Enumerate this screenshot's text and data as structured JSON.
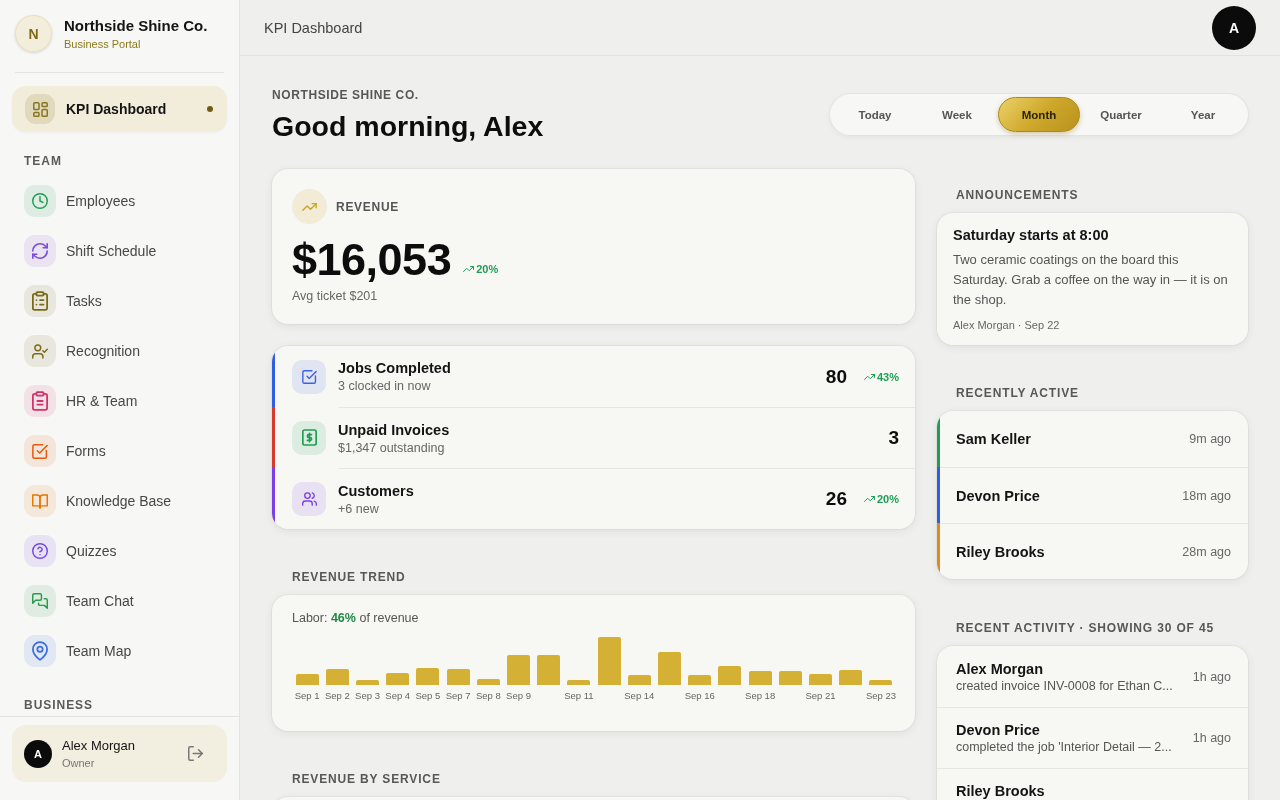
{
  "sidebar": {
    "brand": {
      "initial": "N",
      "name": "Northside Shine Co.",
      "subtitle": "Business Portal"
    },
    "nav": [
      {
        "label": "KPI Dashboard",
        "color": "#8a7520",
        "selected": true
      }
    ],
    "sections": [
      {
        "title": "TEAM",
        "items": [
          {
            "label": "Employees",
            "color": "#1f9d55",
            "selected": false
          },
          {
            "label": "Shift Schedule",
            "color": "#7c4ddb",
            "selected": false
          },
          {
            "label": "Tasks",
            "color": "#7a6a1a",
            "selected": false
          },
          {
            "label": "Recognition",
            "color": "#7a6a1a",
            "selected": false
          },
          {
            "label": "HR & Team",
            "color": "#d6336c",
            "selected": false
          },
          {
            "label": "Forms",
            "color": "#e8590c",
            "selected": false
          },
          {
            "label": "Knowledge Base",
            "color": "#e67700",
            "selected": false
          },
          {
            "label": "Quizzes",
            "color": "#7048e8",
            "selected": false
          },
          {
            "label": "Team Chat",
            "color": "#2b9a4a",
            "selected": false
          },
          {
            "label": "Team Map",
            "color": "#3b6fe0",
            "selected": false
          }
        ]
      },
      {
        "title": "BUSINESS"
      }
    ],
    "user": {
      "initial": "A",
      "name": "Alex Morgan",
      "role": "Owner"
    }
  },
  "topbar": {
    "title": "KPI Dashboard",
    "avatar": "A"
  },
  "header": {
    "eyebrow": "NORTHSIDE SHINE CO.",
    "greeting": "Good morning, Alex"
  },
  "periods": [
    {
      "label": "Today",
      "selected": false
    },
    {
      "label": "Week",
      "selected": false
    },
    {
      "label": "Month",
      "selected": true
    },
    {
      "label": "Quarter",
      "selected": false
    },
    {
      "label": "Year",
      "selected": false
    }
  ],
  "revenue": {
    "label": "REVENUE",
    "value": "$16,053",
    "trend": "20%",
    "note": "Avg ticket $201"
  },
  "kpis": [
    {
      "title": "Jobs Completed",
      "subtitle": "3 clocked in now",
      "value": "80",
      "trend": "43%",
      "color": "#2f5fe0"
    },
    {
      "title": "Unpaid Invoices",
      "subtitle": "$1,347 outstanding",
      "value": "3",
      "color": "#d63a2f"
    },
    {
      "title": "Customers",
      "subtitle": "+6 new",
      "value": "26",
      "trend": "20%",
      "color": "#7b3fe4"
    }
  ],
  "revenue_trend": {
    "heading": "REVENUE TREND",
    "note": "Labor: **46%** of revenue",
    "x_labels": [
      "Sep 1",
      "Sep 2",
      "Sep 3",
      "Sep 4",
      "Sep 5",
      "Sep 7",
      "Sep 8",
      "Sep 9",
      "Sep 11",
      "Sep 14",
      "Sep 16",
      "Sep 18",
      "Sep 21",
      "Sep 23"
    ]
  },
  "revenue_by_service": {
    "heading": "REVENUE BY SERVICE"
  },
  "announcements": {
    "heading": "ANNOUNCEMENTS",
    "items": [
      {
        "title": "Saturday starts at 8:00",
        "body": "Two ceramic coatings on the board this Saturday. Grab a coffee on the way in — it is on the shop.",
        "meta": "Alex Morgan · Sep 22"
      }
    ]
  },
  "recently_active": {
    "heading": "RECENTLY ACTIVE",
    "items": [
      {
        "name": "Sam Keller",
        "time": "9m ago",
        "color": "#1f9d55"
      },
      {
        "name": "Devon Price",
        "time": "18m ago",
        "color": "#2f5fe0"
      },
      {
        "name": "Riley Brooks",
        "time": "28m ago",
        "color": "#e08a1a"
      }
    ]
  },
  "recent_activity": {
    "heading": "RECENT ACTIVITY · SHOWING 30 OF 45",
    "items": [
      {
        "name": "Alex Morgan",
        "description": "created invoice INV-0008 for Ethan C...",
        "time": "1h ago"
      },
      {
        "name": "Devon Price",
        "description": "completed the job 'Interior Detail — 2...",
        "time": "1h ago"
      },
      {
        "name": "Riley Brooks"
      }
    ]
  }
}
